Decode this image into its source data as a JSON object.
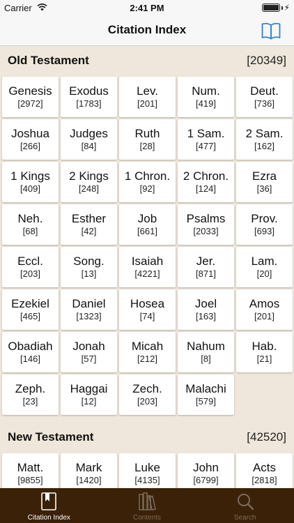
{
  "status_bar": {
    "carrier": "Carrier",
    "time": "2:41 PM"
  },
  "nav": {
    "title": "Citation Index"
  },
  "sections": [
    {
      "title": "Old Testament",
      "count": "[20349]",
      "books": [
        {
          "name": "Genesis",
          "count": "[2972]"
        },
        {
          "name": "Exodus",
          "count": "[1783]"
        },
        {
          "name": "Lev.",
          "count": "[201]"
        },
        {
          "name": "Num.",
          "count": "[419]"
        },
        {
          "name": "Deut.",
          "count": "[736]"
        },
        {
          "name": "Joshua",
          "count": "[266]"
        },
        {
          "name": "Judges",
          "count": "[84]"
        },
        {
          "name": "Ruth",
          "count": "[28]"
        },
        {
          "name": "1 Sam.",
          "count": "[477]"
        },
        {
          "name": "2 Sam.",
          "count": "[162]"
        },
        {
          "name": "1 Kings",
          "count": "[409]"
        },
        {
          "name": "2 Kings",
          "count": "[248]"
        },
        {
          "name": "1 Chron.",
          "count": "[92]"
        },
        {
          "name": "2 Chron.",
          "count": "[124]"
        },
        {
          "name": "Ezra",
          "count": "[36]"
        },
        {
          "name": "Neh.",
          "count": "[68]"
        },
        {
          "name": "Esther",
          "count": "[42]"
        },
        {
          "name": "Job",
          "count": "[661]"
        },
        {
          "name": "Psalms",
          "count": "[2033]"
        },
        {
          "name": "Prov.",
          "count": "[693]"
        },
        {
          "name": "Eccl.",
          "count": "[203]"
        },
        {
          "name": "Song.",
          "count": "[13]"
        },
        {
          "name": "Isaiah",
          "count": "[4221]"
        },
        {
          "name": "Jer.",
          "count": "[871]"
        },
        {
          "name": "Lam.",
          "count": "[20]"
        },
        {
          "name": "Ezekiel",
          "count": "[465]"
        },
        {
          "name": "Daniel",
          "count": "[1323]"
        },
        {
          "name": "Hosea",
          "count": "[74]"
        },
        {
          "name": "Joel",
          "count": "[163]"
        },
        {
          "name": "Amos",
          "count": "[201]"
        },
        {
          "name": "Obadiah",
          "count": "[146]"
        },
        {
          "name": "Jonah",
          "count": "[57]"
        },
        {
          "name": "Micah",
          "count": "[212]"
        },
        {
          "name": "Nahum",
          "count": "[8]"
        },
        {
          "name": "Hab.",
          "count": "[21]"
        },
        {
          "name": "Zeph.",
          "count": "[23]"
        },
        {
          "name": "Haggai",
          "count": "[12]"
        },
        {
          "name": "Zech.",
          "count": "[203]"
        },
        {
          "name": "Malachi",
          "count": "[579]"
        }
      ]
    },
    {
      "title": "New Testament",
      "count": "[42520]",
      "books": [
        {
          "name": "Matt.",
          "count": "[9855]"
        },
        {
          "name": "Mark",
          "count": "[1420]"
        },
        {
          "name": "Luke",
          "count": "[4135]"
        },
        {
          "name": "John",
          "count": "[6799]"
        },
        {
          "name": "Acts",
          "count": "[2818]"
        }
      ]
    }
  ],
  "tabs": [
    {
      "label": "Citation Index",
      "icon": "bookmark-book-icon",
      "active": true
    },
    {
      "label": "Contents",
      "icon": "books-shelf-icon",
      "active": false
    },
    {
      "label": "Search",
      "icon": "search-icon",
      "active": false
    }
  ],
  "colors": {
    "background": "#efe7db",
    "tab_bar": "#3b2108",
    "accent": "#2f7fd6",
    "tab_inactive": "#7b6a5a"
  }
}
